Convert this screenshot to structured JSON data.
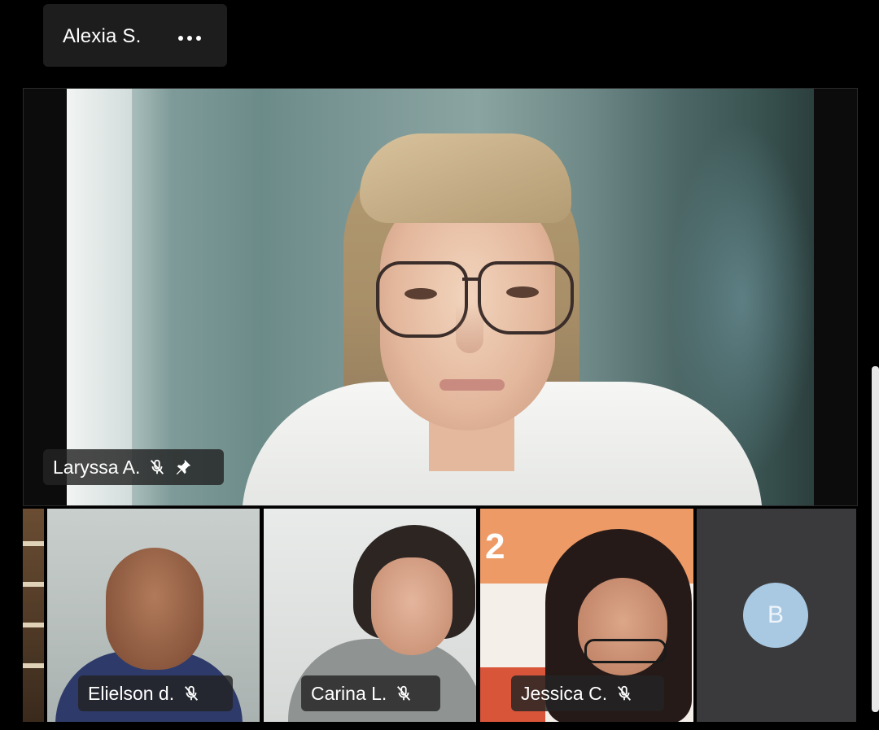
{
  "self_tile": {
    "name": "Alexia S.",
    "more_icon": "more-horizontal-icon"
  },
  "main_speaker": {
    "name": "Laryssa A.",
    "muted": true,
    "pinned": true
  },
  "participants": [
    {
      "name": "Elielson d.",
      "status_icon": "mic-off-icon"
    },
    {
      "name": "Carina L.",
      "status_icon": "mic-off-icon"
    },
    {
      "name": "Jessica C.",
      "status_icon": "mic-off-icon"
    },
    {
      "avatar_initial": "B",
      "avatar_color": "#a9c9e3"
    }
  ],
  "jessica_background": {
    "banner_number": "2"
  },
  "colors": {
    "background": "#000000",
    "tile": "#1d1d1e",
    "pill": "#232323",
    "avatar": "#a9c9e3"
  }
}
